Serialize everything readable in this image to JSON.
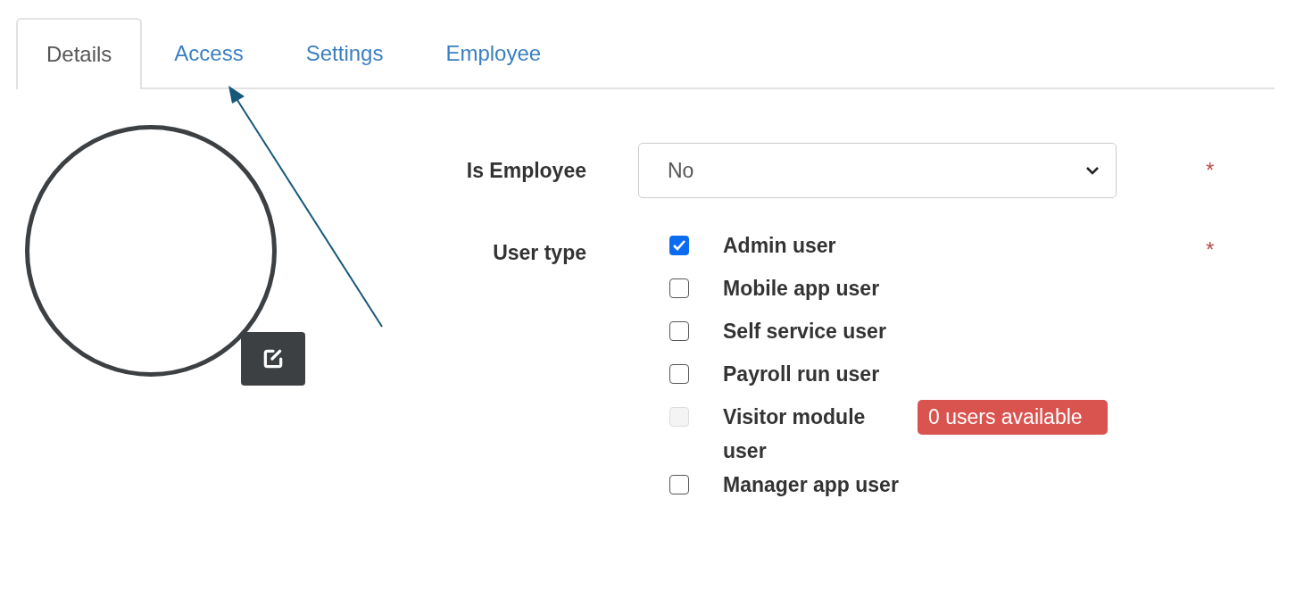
{
  "tabs": [
    {
      "label": "Details",
      "selected": true
    },
    {
      "label": "Access",
      "selected": false
    },
    {
      "label": "Settings",
      "selected": false
    },
    {
      "label": "Employee",
      "selected": false
    }
  ],
  "form": {
    "is_employee": {
      "label": "Is Employee",
      "value": "No",
      "required_mark": "*"
    },
    "user_type": {
      "label": "User type",
      "required_mark": "*",
      "options": [
        {
          "label": "Admin user",
          "checked": true,
          "disabled": false
        },
        {
          "label": "Mobile app user",
          "checked": false,
          "disabled": false
        },
        {
          "label": "Self service user",
          "checked": false,
          "disabled": false
        },
        {
          "label": "Payroll run user",
          "checked": false,
          "disabled": false
        },
        {
          "label": "Visitor module user",
          "checked": false,
          "disabled": true,
          "badge": "0 users available"
        },
        {
          "label": "Manager app user",
          "checked": false,
          "disabled": false
        }
      ]
    }
  }
}
